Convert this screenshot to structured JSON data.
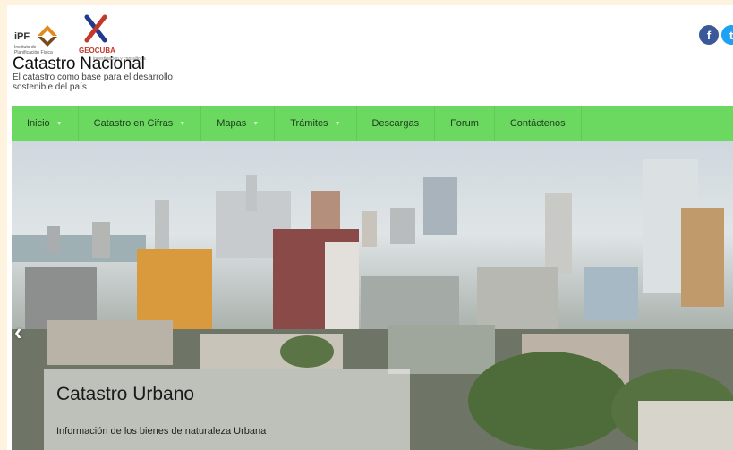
{
  "header": {
    "ipf_logo_text": "iPF",
    "ipf_logo_sub": "Instituto de Planificación Física",
    "geocuba_logo_text": "GEOCUBA",
    "geocuba_logo_sub": "investigación y consultoría",
    "site_title": "Catastro Nacional",
    "tagline": "El catastro como base para el desarrollo sostenible del país"
  },
  "social": {
    "facebook_icon": "f",
    "twitter_icon": "t"
  },
  "nav": {
    "items": [
      {
        "label": "Inicio",
        "has_dropdown": true
      },
      {
        "label": "Catastro en Cifras",
        "has_dropdown": true
      },
      {
        "label": "Mapas",
        "has_dropdown": true
      },
      {
        "label": "Trámites",
        "has_dropdown": true
      },
      {
        "label": "Descargas",
        "has_dropdown": false
      },
      {
        "label": "Forum",
        "has_dropdown": false
      },
      {
        "label": "Contáctenos",
        "has_dropdown": false
      }
    ]
  },
  "slider": {
    "prev_icon": "chevron-left-icon",
    "caption_title": "Catastro Urbano",
    "caption_text": "Información de los bienes de naturaleza Urbana"
  },
  "colors": {
    "nav_bg": "#6bd960",
    "page_bg": "#fdf3df",
    "facebook": "#3b5998",
    "twitter": "#1da1f2"
  }
}
